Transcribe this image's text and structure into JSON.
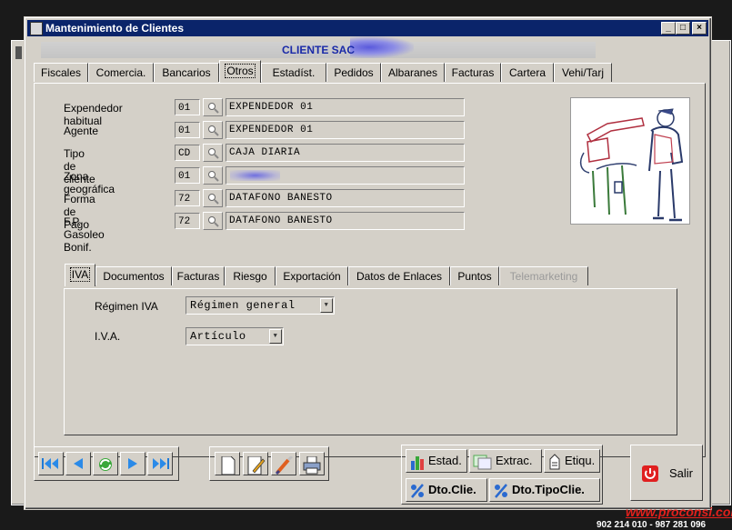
{
  "window": {
    "title": "Mantenimiento de Clientes",
    "minimize": "_",
    "maximize": "□",
    "close": "×"
  },
  "cliente_banner": "CLIENTE SAC",
  "main_tabs": [
    {
      "label": "Fiscales"
    },
    {
      "label": "Comercia."
    },
    {
      "label": "Bancarios"
    },
    {
      "label": "Otros",
      "selected": true
    },
    {
      "label": "Estadíst."
    },
    {
      "label": "Pedidos"
    },
    {
      "label": "Albaranes"
    },
    {
      "label": "Facturas"
    },
    {
      "label": "Cartera"
    },
    {
      "label": "Vehi/Tarj"
    }
  ],
  "fields": [
    {
      "label": "Expendedor habitual",
      "code": "01",
      "value": "EXPENDEDOR 01"
    },
    {
      "label": "Agente",
      "code": "01",
      "value": "EXPENDEDOR 01"
    },
    {
      "label": "Tipo de cliente",
      "code": "CD",
      "value": "CAJA DIARIA"
    },
    {
      "label": "Zona geográfica",
      "code": "01",
      "value": ""
    },
    {
      "label": "Forma de Pago",
      "code": "72",
      "value": "DATAFONO BANESTO"
    },
    {
      "label": "F.P. Gasoleo Bonif.",
      "code": "72",
      "value": "DATAFONO BANESTO"
    }
  ],
  "sub_tabs": [
    {
      "label": "IVA",
      "selected": true
    },
    {
      "label": "Documentos"
    },
    {
      "label": "Facturas"
    },
    {
      "label": "Riesgo"
    },
    {
      "label": "Exportación"
    },
    {
      "label": "Datos de Enlaces"
    },
    {
      "label": "Puntos"
    },
    {
      "label": "Telemarketing",
      "disabled": true
    }
  ],
  "iva_panel": {
    "regimen_label": "Régimen IVA",
    "regimen_value": "Régimen general",
    "iva_label": "I.V.A.",
    "iva_value": "Artículo"
  },
  "nav_icons": [
    "first-record-icon",
    "previous-record-icon",
    "refresh-icon",
    "next-record-icon",
    "last-record-icon"
  ],
  "edit_icons": [
    "new-document-icon",
    "edit-icon",
    "brush-icon",
    "print-icon"
  ],
  "action_buttons": {
    "estad": "Estad.",
    "extrac": "Extrac.",
    "etiqu": "Etiqu.",
    "dto_clie": "Dto.Clie.",
    "dto_tipo": "Dto.TipoClie.",
    "salir": "Salir"
  },
  "footer": {
    "web": "www.proconsi.com",
    "phone": "902 214 010 - 987 281 096"
  },
  "colors": {
    "titlebar": "#0a246a",
    "banner_text": "#1a2aa8",
    "web_text": "#e0201c",
    "window_bg": "#d4d0c8"
  }
}
